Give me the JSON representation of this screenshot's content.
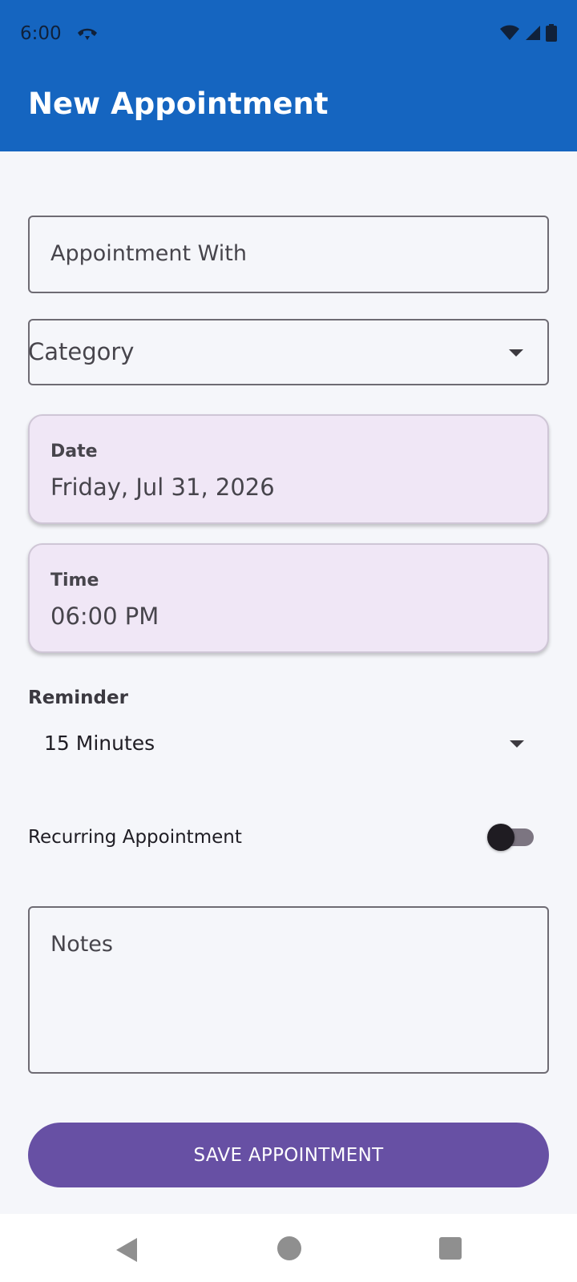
{
  "status_bar": {
    "time": "6:00",
    "icons": [
      "call-end-icon",
      "wifi-icon",
      "cellular-signal-icon",
      "battery-icon"
    ]
  },
  "app_bar": {
    "title": "New Appointment"
  },
  "form": {
    "appointment_with": {
      "placeholder": "Appointment With",
      "value": ""
    },
    "category": {
      "placeholder": "Category",
      "value": ""
    },
    "date": {
      "label": "Date",
      "value": "Friday, Jul 31, 2026"
    },
    "time": {
      "label": "Time",
      "value": "06:00 PM"
    },
    "reminder": {
      "label": "Reminder",
      "value": "15 Minutes"
    },
    "recurring": {
      "label": "Recurring Appointment",
      "enabled": false
    },
    "notes": {
      "placeholder": "Notes",
      "value": ""
    },
    "save_label": "SAVE APPOINTMENT"
  },
  "nav_bar": {
    "icons": [
      "back-icon",
      "home-icon",
      "recents-icon"
    ]
  },
  "colors": {
    "app_bar": "#1565c0",
    "background": "#f5f6fa",
    "card": "#f0e7f6",
    "primary_button": "#6750a4"
  }
}
